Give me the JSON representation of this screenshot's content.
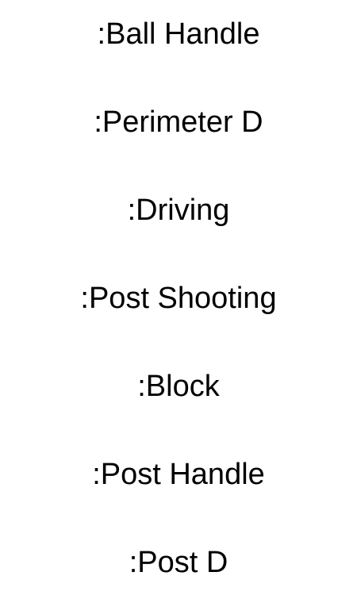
{
  "labels": [
    ":Ball Handle",
    ":Perimeter D",
    ":Driving",
    ":Post Shooting",
    ":Block",
    ":Post Handle",
    ":Post D"
  ],
  "colors": {
    "background": "#ffffff",
    "text": "#000000"
  }
}
